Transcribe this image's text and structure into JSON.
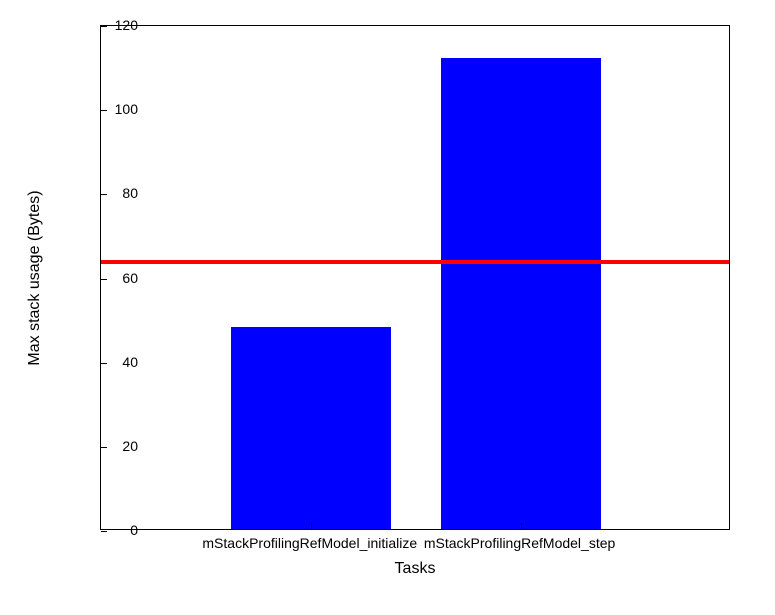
{
  "chart_data": {
    "type": "bar",
    "categories": [
      "mStackProfilingRefModel_initialize",
      "mStackProfilingRefModel_step"
    ],
    "values": [
      48,
      112
    ],
    "title": "",
    "xlabel": "Tasks",
    "ylabel": "Max stack usage (Bytes)",
    "ylim": [
      0,
      120
    ],
    "yticks": [
      0,
      20,
      40,
      60,
      80,
      100,
      120
    ],
    "reference_line": 64
  }
}
